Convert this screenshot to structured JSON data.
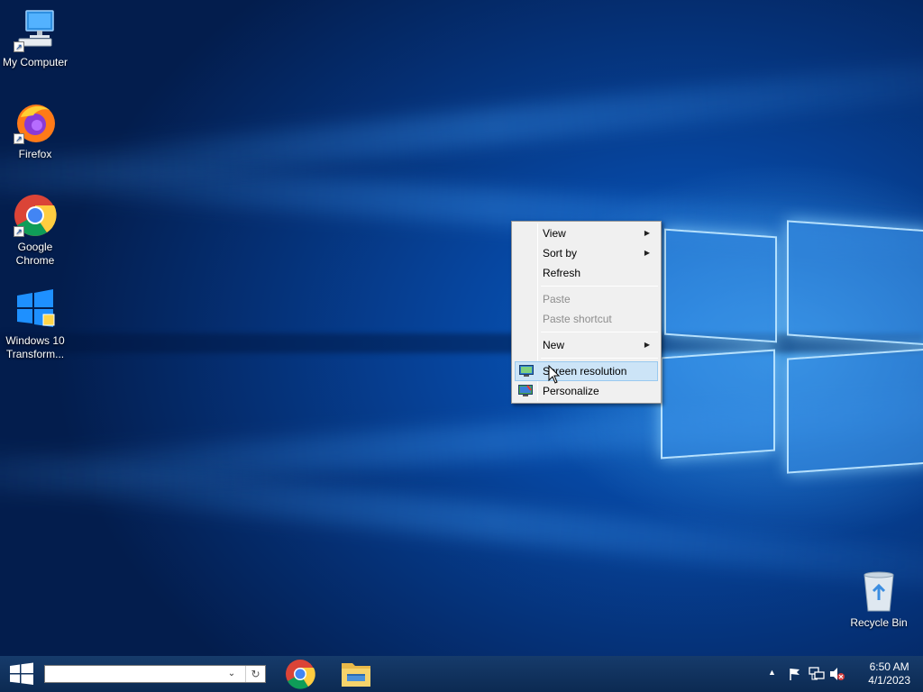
{
  "desktop": {
    "icons": [
      {
        "label": "My Computer"
      },
      {
        "label": "Firefox"
      },
      {
        "label": "Google Chrome"
      },
      {
        "label": "Windows 10 Transform..."
      },
      {
        "label": "Recycle Bin"
      }
    ]
  },
  "context_menu": {
    "items": [
      {
        "label": "View",
        "submenu": true
      },
      {
        "label": "Sort by",
        "submenu": true
      },
      {
        "label": "Refresh"
      },
      {
        "label": "Paste",
        "disabled": true
      },
      {
        "label": "Paste shortcut",
        "disabled": true
      },
      {
        "label": "New",
        "submenu": true
      },
      {
        "label": "Screen resolution",
        "highlighted": true,
        "icon": "display-settings-icon"
      },
      {
        "label": "Personalize",
        "icon": "personalize-icon"
      }
    ]
  },
  "taskbar": {
    "search": {
      "value": "",
      "placeholder": ""
    },
    "apps": [
      {
        "name": "Google Chrome",
        "icon": "chrome-icon"
      },
      {
        "name": "File Explorer",
        "icon": "folder-icon"
      }
    ],
    "clock": {
      "time": "6:50 AM",
      "date": "4/1/2023"
    }
  },
  "colors": {
    "accent": "#0a5fc4",
    "taskbar": "#0c2a52",
    "menu_highlight": "#cce4f7"
  }
}
